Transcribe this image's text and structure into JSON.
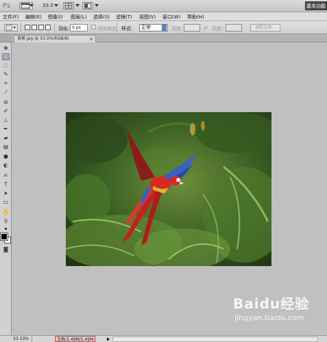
{
  "app": {
    "logo_text": "Ps",
    "zoom_value": "33.3",
    "workspace_label": "基本功能"
  },
  "menu": {
    "items": [
      "文件(F)",
      "编辑(E)",
      "图像(I)",
      "图层(L)",
      "选择(S)",
      "滤镜(T)",
      "视图(V)",
      "窗口(W)",
      "帮助(H)"
    ]
  },
  "options": {
    "feather_label": "羽化:",
    "feather_value": "0 px",
    "antialias_label": "消除锯齿",
    "style_label": "样式:",
    "style_value": "正常",
    "width_label": "宽度:",
    "height_label": "高度:",
    "refine_edge_label": "调整边缘..."
  },
  "document": {
    "tab_title": "背景.jpg @ 33.3%(RGB/8)",
    "close_glyph": "×"
  },
  "tools": {
    "icons": [
      "move-tool-icon",
      "marquee-tool-icon",
      "lasso-tool-icon",
      "quick-select-tool-icon",
      "crop-tool-icon",
      "eyedropper-tool-icon",
      "healing-brush-tool-icon",
      "brush-tool-icon",
      "clone-stamp-tool-icon",
      "history-brush-tool-icon",
      "eraser-tool-icon",
      "gradient-tool-icon",
      "blur-tool-icon",
      "dodge-tool-icon",
      "pen-tool-icon",
      "type-tool-icon",
      "path-select-tool-icon",
      "shape-tool-icon",
      "hand-tool-icon",
      "zoom-tool-icon"
    ],
    "foreground_color": "#000000",
    "background_color": "#ffffff"
  },
  "status": {
    "zoom": "33.33%",
    "doc_size": "文档:5.49M/5.49M"
  },
  "watermark": {
    "main": "Baidu经验",
    "sub": "jingyan.baidu.com"
  },
  "colors": {
    "accent_active_tool": "#aeb6c2",
    "doc_size_highlight": "#d04040"
  }
}
